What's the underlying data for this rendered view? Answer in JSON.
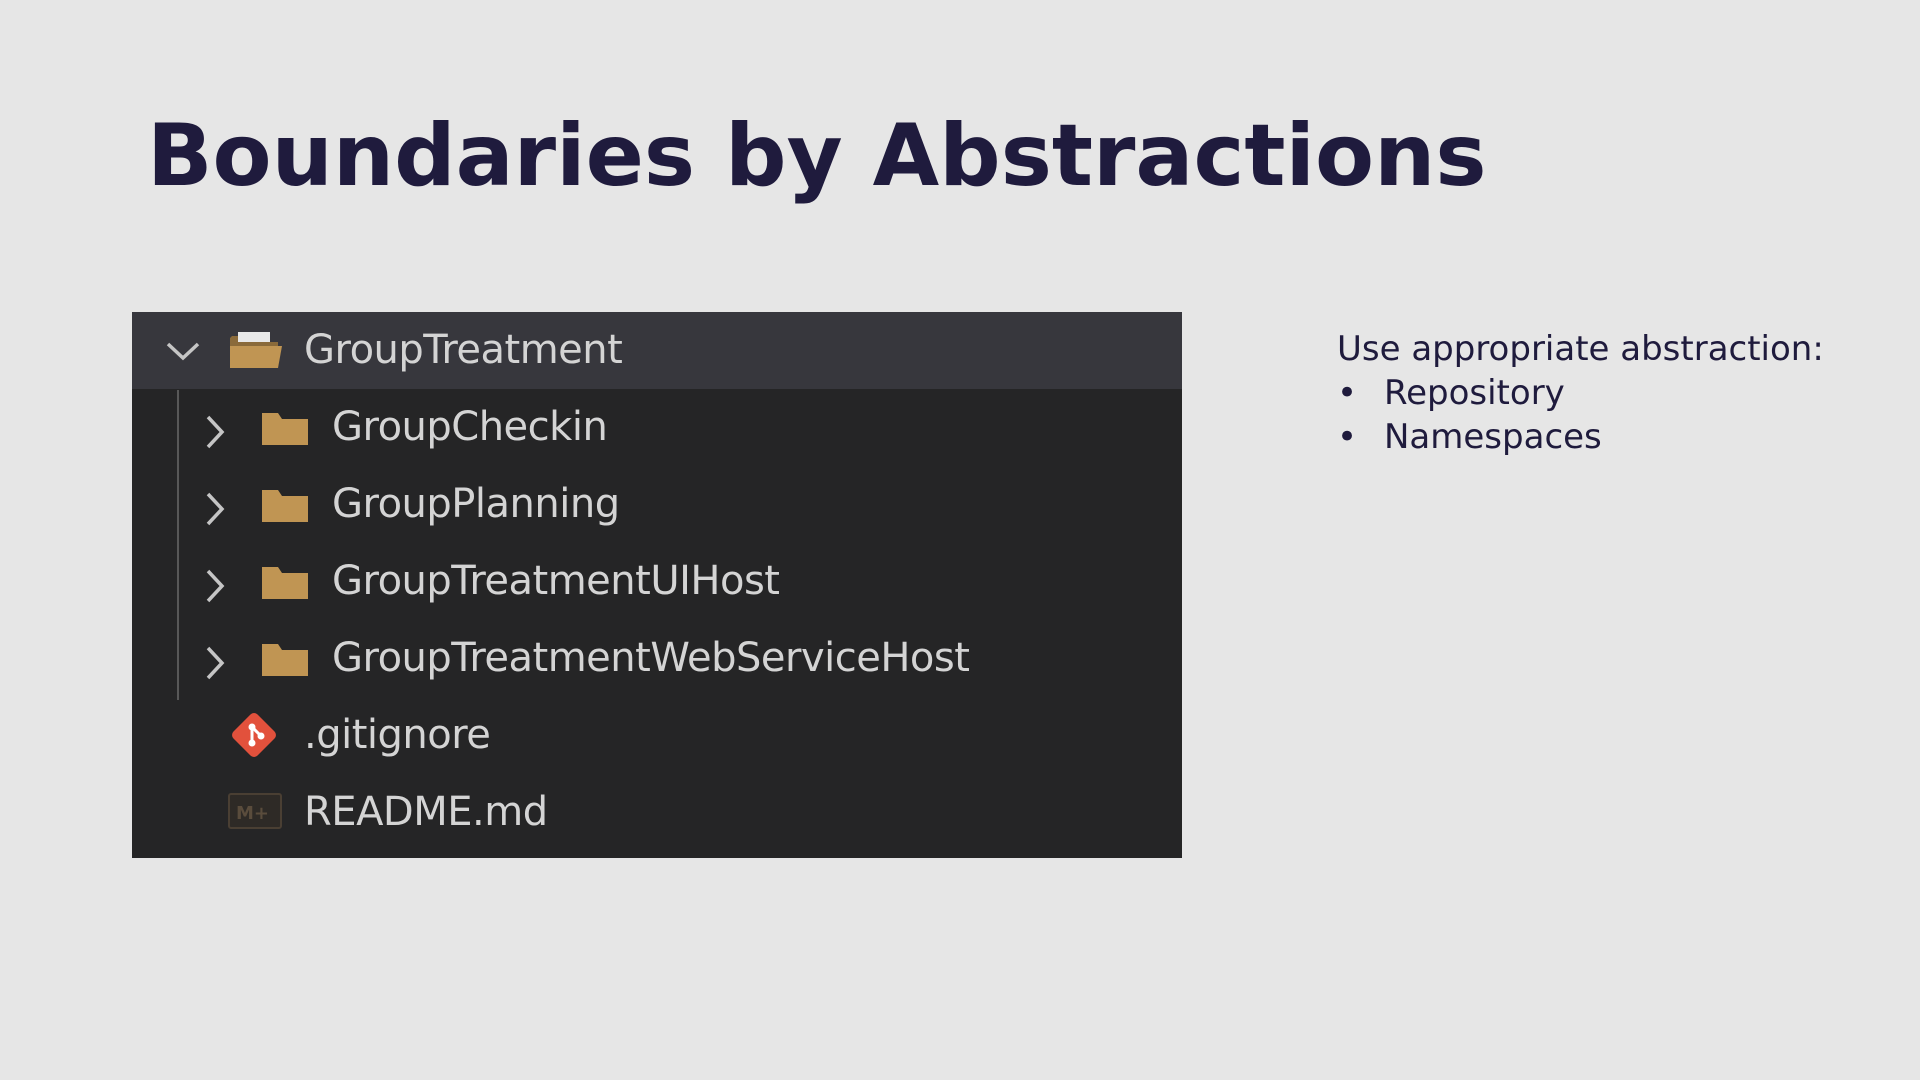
{
  "slide": {
    "title": "Boundaries by Abstractions"
  },
  "explorer": {
    "root": {
      "label": "GroupTreatment",
      "expanded": true,
      "icon": "folder-open-icon"
    },
    "folders": [
      {
        "label": "GroupCheckin",
        "icon": "folder-icon",
        "expanded": false
      },
      {
        "label": "GroupPlanning",
        "icon": "folder-icon",
        "expanded": false
      },
      {
        "label": "GroupTreatmentUIHost",
        "icon": "folder-icon",
        "expanded": false
      },
      {
        "label": "GroupTreatmentWebServiceHost",
        "icon": "folder-icon",
        "expanded": false
      }
    ],
    "files": [
      {
        "label": ".gitignore",
        "icon": "git-icon"
      },
      {
        "label": "README.md",
        "icon": "markdown-icon"
      }
    ],
    "colors": {
      "background": "#252526",
      "selected_row": "#37373d",
      "folder": "#c09553",
      "git": "#e2513c",
      "text": "#d4d4d4"
    }
  },
  "notes": {
    "intro": "Use appropriate abstraction:",
    "bullet_symbol": "•",
    "items": [
      "Repository",
      "Namespaces"
    ]
  }
}
